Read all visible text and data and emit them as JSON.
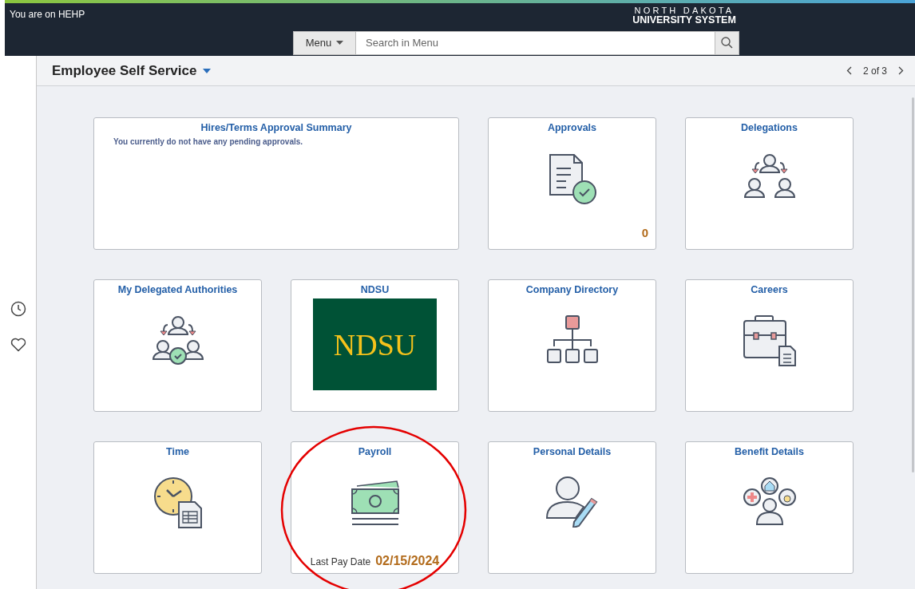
{
  "header": {
    "location": "You are on HEHP",
    "logo_top": "NORTH DAKOTA",
    "logo_bottom": "UNIVERSITY SYSTEM",
    "menu_button": "Menu",
    "search": {
      "placeholder": "Search in Menu"
    }
  },
  "page": {
    "title": "Employee Self Service",
    "pager": "2 of 3"
  },
  "tiles": [
    {
      "kind": "summary",
      "title": "Hires/Terms Approval Summary",
      "message": "You currently do not have any pending approvals."
    },
    {
      "kind": "approvals",
      "title": "Approvals",
      "count": "0"
    },
    {
      "kind": "delegations",
      "title": "Delegations"
    },
    {
      "kind": "delegated",
      "title": "My Delegated Authorities"
    },
    {
      "kind": "logo",
      "title": "NDSU",
      "logo_text": "NDSU"
    },
    {
      "kind": "directory",
      "title": "Company Directory"
    },
    {
      "kind": "careers",
      "title": "Careers"
    },
    {
      "kind": "time",
      "title": "Time"
    },
    {
      "kind": "payroll",
      "title": "Payroll",
      "pay_label": "Last Pay Date",
      "pay_date": "02/15/2024"
    },
    {
      "kind": "personal",
      "title": "Personal Details"
    },
    {
      "kind": "benefits",
      "title": "Benefit Details"
    }
  ]
}
